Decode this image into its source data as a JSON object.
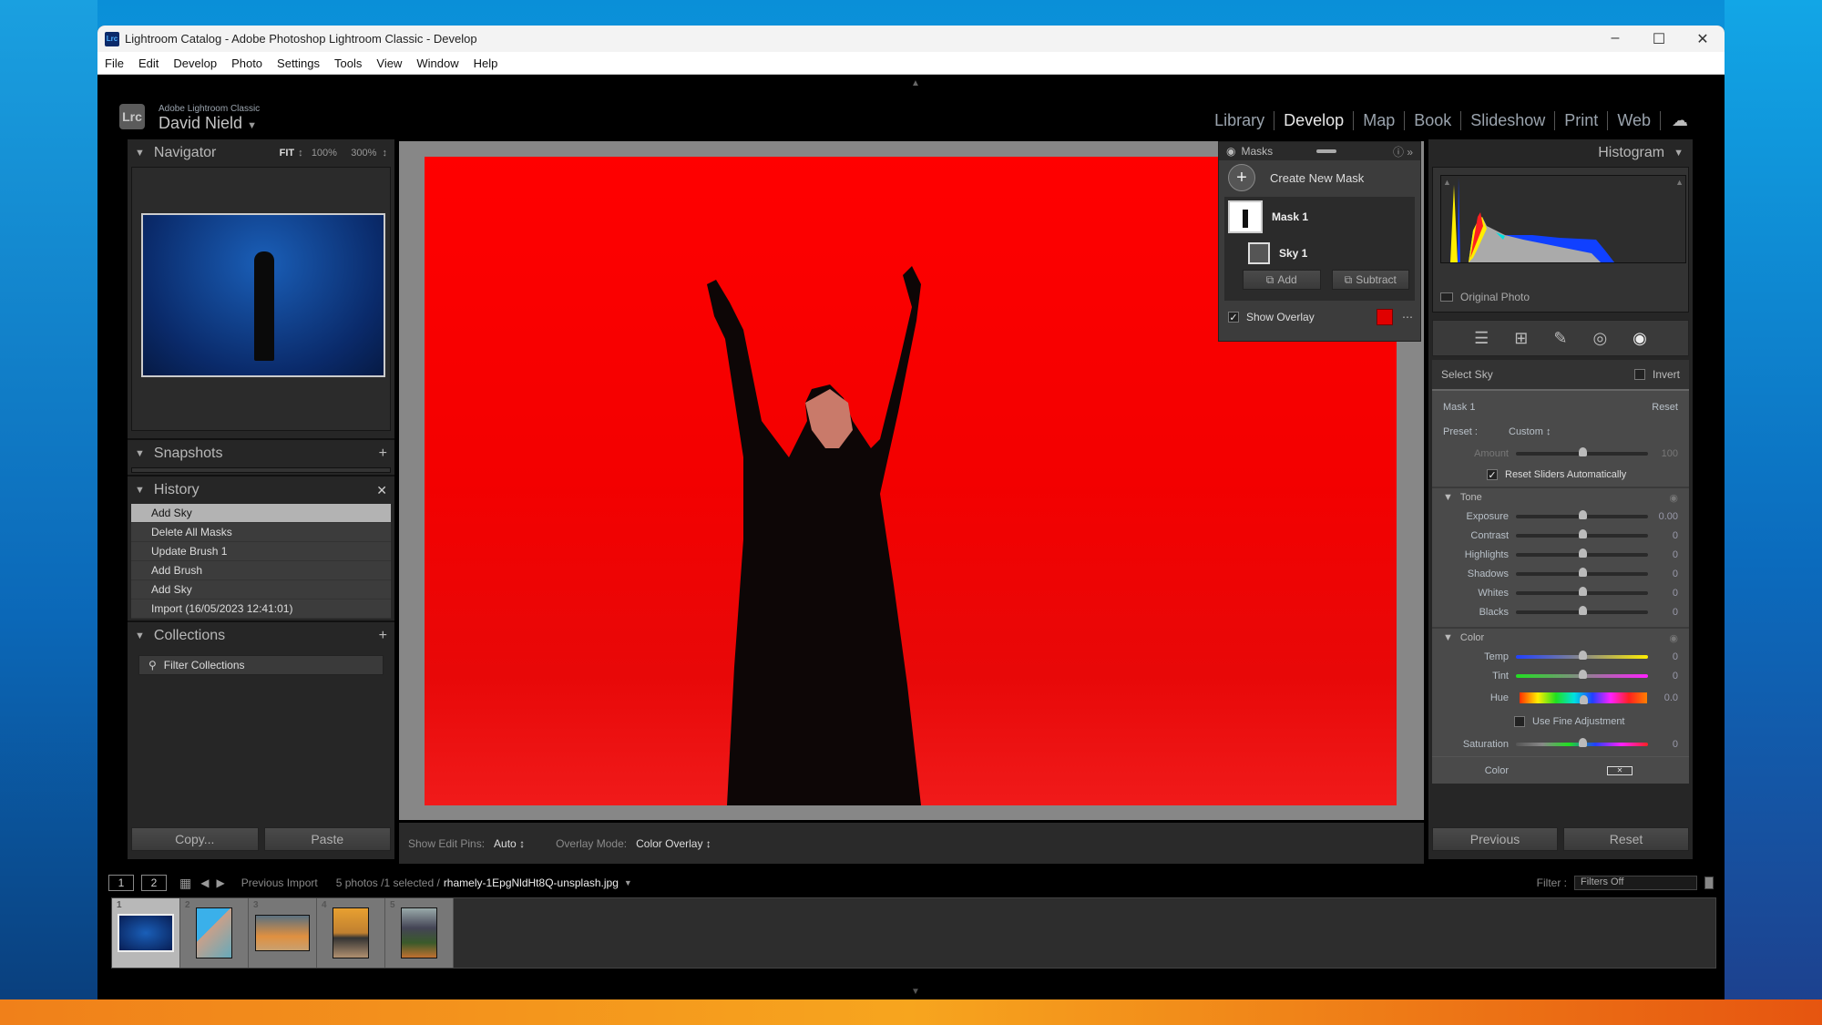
{
  "window": {
    "title": "Lightroom Catalog - Adobe Photoshop Lightroom Classic - Develop",
    "app_icon": "Lrc",
    "controls": [
      "minimize-icon",
      "maximize-icon",
      "close-icon"
    ]
  },
  "menu": [
    "File",
    "Edit",
    "Develop",
    "Photo",
    "Settings",
    "Tools",
    "View",
    "Window",
    "Help"
  ],
  "identity": {
    "logo": "Lrc",
    "product": "Adobe Lightroom Classic",
    "user": "David Nield"
  },
  "modules": [
    {
      "label": "Library",
      "active": false
    },
    {
      "label": "Develop",
      "active": true
    },
    {
      "label": "Map",
      "active": false
    },
    {
      "label": "Book",
      "active": false
    },
    {
      "label": "Slideshow",
      "active": false
    },
    {
      "label": "Print",
      "active": false
    },
    {
      "label": "Web",
      "active": false
    }
  ],
  "left": {
    "navigator": {
      "title": "Navigator",
      "zoom_fit": "FIT",
      "zoom_100": "100%",
      "zoom_300": "300%"
    },
    "snapshots": {
      "title": "Snapshots"
    },
    "history": {
      "title": "History",
      "items": [
        "Add Sky",
        "Delete All Masks",
        "Update Brush 1",
        "Add Brush",
        "Add Sky",
        "Import (16/05/2023 12:41:01)"
      ],
      "selected_index": 0
    },
    "collections": {
      "title": "Collections",
      "filter_placeholder": "Filter Collections"
    },
    "copy_label": "Copy...",
    "paste_label": "Paste"
  },
  "toolbar": {
    "edit_pins_label": "Show Edit Pins:",
    "edit_pins_value": "Auto",
    "overlay_mode_label": "Overlay Mode:",
    "overlay_mode_value": "Color Overlay"
  },
  "masks": {
    "title": "Masks",
    "create_label": "Create New Mask",
    "mask_name": "Mask 1",
    "component_name": "Sky 1",
    "add_label": "Add",
    "subtract_label": "Subtract",
    "show_overlay_label": "Show Overlay",
    "show_overlay_checked": true,
    "overlay_color": "#e00000"
  },
  "right": {
    "histogram": {
      "title": "Histogram",
      "original_photo_label": "Original Photo"
    },
    "select_label": "Select Sky",
    "invert_label": "Invert",
    "mask_label": "Mask 1",
    "reset_label": "Reset",
    "preset_label": "Preset :",
    "preset_value": "Custom",
    "amount": {
      "label": "Amount",
      "value": "100",
      "fraction": 0.5
    },
    "reset_sliders_label": "Reset Sliders Automatically",
    "tone": {
      "title": "Tone",
      "sliders": [
        {
          "label": "Exposure",
          "value": "0.00",
          "fraction": 0.5
        },
        {
          "label": "Contrast",
          "value": "0",
          "fraction": 0.5
        },
        {
          "label": "Highlights",
          "value": "0",
          "fraction": 0.5
        },
        {
          "label": "Shadows",
          "value": "0",
          "fraction": 0.5
        },
        {
          "label": "Whites",
          "value": "0",
          "fraction": 0.5
        },
        {
          "label": "Blacks",
          "value": "0",
          "fraction": 0.5
        }
      ]
    },
    "color": {
      "title": "Color",
      "temp": {
        "label": "Temp",
        "value": "0",
        "fraction": 0.5
      },
      "tint": {
        "label": "Tint",
        "value": "0",
        "fraction": 0.5
      },
      "hue": {
        "label": "Hue",
        "value": "0.0",
        "fraction": 0.5
      },
      "fine_adjust_label": "Use Fine Adjustment",
      "saturation": {
        "label": "Saturation",
        "value": "0",
        "fraction": 0.5
      },
      "color_label": "Color"
    },
    "previous_label": "Previous",
    "reset_button_label": "Reset"
  },
  "filmstrip": {
    "view1": "1",
    "view2": "2",
    "source": "Previous Import",
    "count": "5 photos /1 selected /",
    "filename": "rhamely-1EpgNldHt8Q-unsplash.jpg",
    "filter_label": "Filter :",
    "filter_value": "Filters Off",
    "thumbs": [
      "1",
      "2",
      "3",
      "4",
      "5"
    ],
    "selected_index": 0
  }
}
